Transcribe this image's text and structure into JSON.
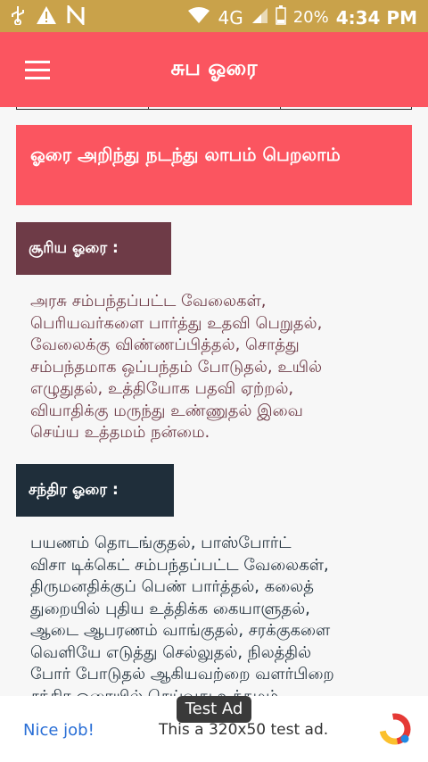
{
  "status_bar": {
    "network": "4G",
    "battery": "20%",
    "time": "4:34 PM",
    "icons": [
      "usb-icon",
      "warning-icon",
      "n-icon",
      "wifi-icon",
      "signal-icon",
      "battery-icon"
    ]
  },
  "app_bar": {
    "title": "சுப ஓரை",
    "menu_icon": "menu-icon"
  },
  "content": {
    "hero_text": "ஓரை அறிந்து நடந்து லாபம் பெறலாம்",
    "sections": [
      {
        "label": "சூரிய ஓரை :",
        "label_color": "#6e3b47",
        "text_color": "#6e3b47",
        "lines": [
          "அரசு சம்பந்தப்பட்ட வேலைகள்,",
          "பெரியவர்களை பார்த்து உதவி பெறுதல்,",
          "வேலைக்கு விண்ணப்பித்தல், சொத்து",
          "சம்பந்தமாக ஒப்பந்தம் போடுதல், உயில்",
          "எழுதுதல், உத்தியோக பதவி ஏற்றல்,",
          "வியாதிக்கு மருந்து உண்ணுதல் இவை",
          "செய்ய உத்தமம் நன்மை."
        ]
      },
      {
        "label": "சந்திர ஓரை :",
        "label_color": "#1f2e3a",
        "text_color": "#1f2e3a",
        "lines": [
          "பயணம் தொடங்குதல், பாஸ்போர்ட்",
          "விசா டிக்கெட் சம்பந்தப்பட்ட வேலைகள்,",
          "திருமனதிக்குப் பெண் பார்த்தல், கலைத்",
          "துறையில் புதிய உத்திக்க கையாளுதல்,",
          "ஆடை ஆபரணம் வாங்குதல், சரக்குகளை",
          "வெளியே எடுத்து செல்லுதல், நிலத்தில்",
          "போர் போடுதல் ஆகியவற்றை வளர்பிறை",
          "சந்திர ஓரையில் செய்வது உத்தமம்."
        ]
      }
    ]
  },
  "ad": {
    "badge": "Test Ad",
    "left_text": "Nice job!",
    "center_text": "This a 320x50 test ad.",
    "logo_icon": "adchoices-logo-icon"
  },
  "colors": {
    "status_bar": "#c9a24a",
    "app_bar": "#fb5560",
    "hero": "#fb5560"
  }
}
